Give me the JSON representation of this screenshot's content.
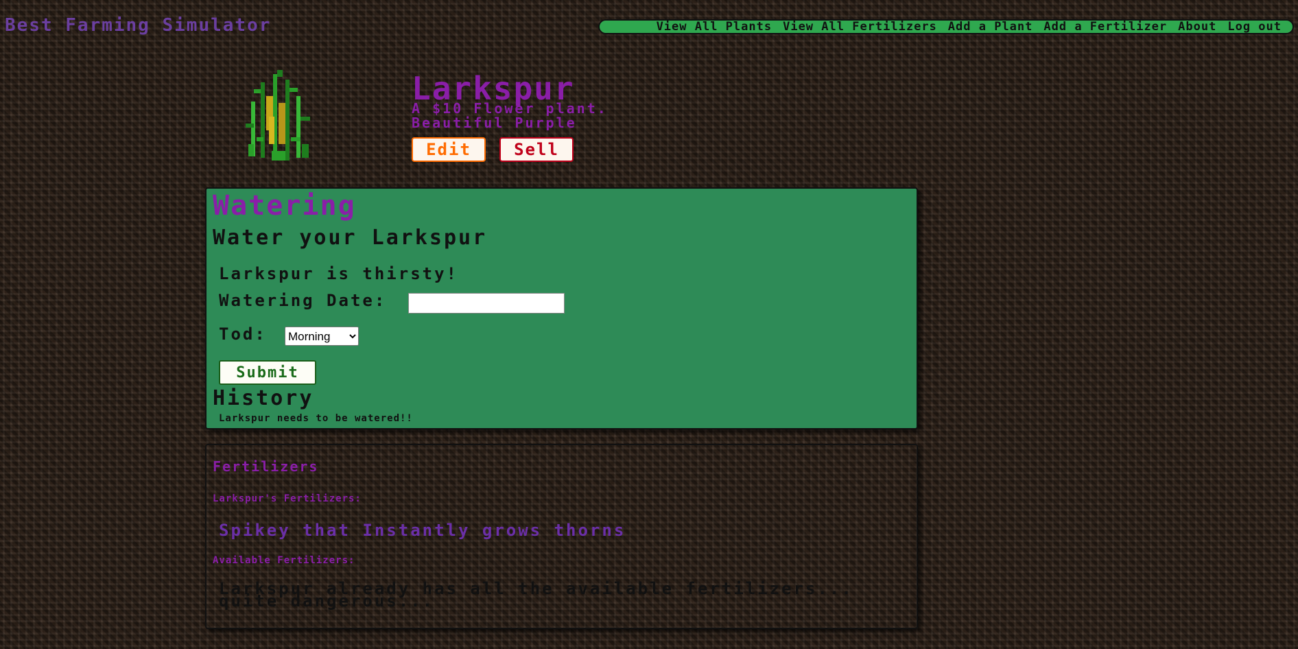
{
  "brand": "Best Farming Simulator",
  "nav": {
    "items": [
      "View All Plants",
      "View All Fertilizers",
      "Add a Plant",
      "Add a Fertilizer",
      "About",
      "Log out"
    ]
  },
  "plant": {
    "image_icon": "corn-stalk-sprite",
    "name": "Larkspur",
    "line1": "A $10 Flower plant.",
    "line2": "Beautiful Purple",
    "edit_label": "Edit",
    "sell_label": "Sell"
  },
  "watering": {
    "title": "Watering",
    "subtitle": "Water your Larkspur",
    "status": "Larkspur is thirsty!",
    "date_label": "Watering Date:",
    "date_value": "",
    "tod_label": "Tod:",
    "tod_selected": "Morning",
    "submit_label": "Submit",
    "history_title": "History",
    "history_note": "Larkspur needs to be watered!!"
  },
  "fertilizers": {
    "title": "Fertilizers",
    "current_label": "Larkspur's Fertilizers:",
    "current_items": [
      "Spikey that Instantly grows thorns"
    ],
    "available_label": "Available Fertilizers:",
    "available_message": "Larkspur already has all the available fertilizers... quite dangerous..."
  },
  "colors": {
    "brand": "#6b3fa0",
    "nav_bg": "#2fa84f",
    "panel_green": "#2e8b57",
    "title_purple": "#8a1ea8",
    "edit_orange": "#ff6b00",
    "sell_red": "#c0001a"
  }
}
